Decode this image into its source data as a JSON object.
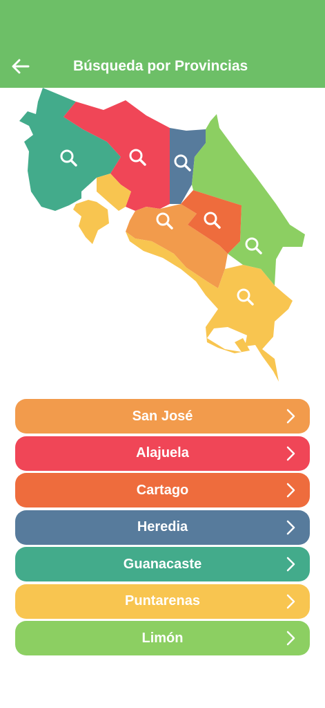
{
  "header": {
    "title": "Búsqueda por Provincias",
    "back_icon": "arrow-left-icon",
    "background": "#6dbf67"
  },
  "map": {
    "search_icon": "magnifier-icon",
    "regions": [
      {
        "name": "Guanacaste",
        "color": "#43ab8b"
      },
      {
        "name": "Alajuela",
        "color": "#f04657"
      },
      {
        "name": "Heredia",
        "color": "#577b9c"
      },
      {
        "name": "Limón",
        "color": "#8ccf62"
      },
      {
        "name": "San José",
        "color": "#f29b4c"
      },
      {
        "name": "Cartago",
        "color": "#ee6c3d"
      },
      {
        "name": "Puntarenas",
        "color": "#f8c550"
      }
    ]
  },
  "provinces": [
    {
      "label": "San José",
      "color": "#f29b4c"
    },
    {
      "label": "Alajuela",
      "color": "#f04657"
    },
    {
      "label": "Cartago",
      "color": "#ee6c3d"
    },
    {
      "label": "Heredia",
      "color": "#577b9c"
    },
    {
      "label": "Guanacaste",
      "color": "#43ab8b"
    },
    {
      "label": "Puntarenas",
      "color": "#f8c550"
    },
    {
      "label": "Limón",
      "color": "#8ccf62"
    }
  ],
  "chevron_icon": "chevron-right-icon"
}
